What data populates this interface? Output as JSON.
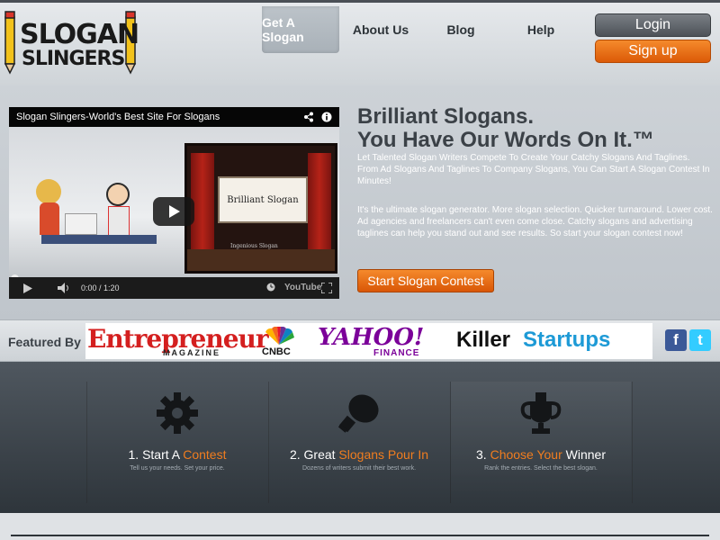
{
  "brand": {
    "line1": "SLOGAN",
    "line2": "SLINGERS"
  },
  "nav": [
    {
      "label": "Get A Slogan",
      "active": true
    },
    {
      "label": "About Us"
    },
    {
      "label": "Blog"
    },
    {
      "label": "Help"
    }
  ],
  "auth": {
    "login": "Login",
    "signup": "Sign up"
  },
  "video": {
    "title": "Slogan Slingers-World's Best Site For Slogans",
    "board_text": "Brilliant Slogan",
    "board_sub": "Ingenious Slogan",
    "time": "0:00 / 1:20",
    "youtube": "YouTube"
  },
  "hero": {
    "title_line1": "Brilliant Slogans.",
    "title_line2": "You Have Our Words On It.™",
    "para1": "Let Talented Slogan Writers Compete To Create Your Catchy Slogans And Taglines. From Ad Slogans And Taglines To Company Slogans, You Can Start A Slogan Contest In Minutes!",
    "para2": "It's the ultimate slogan generator. More slogan selection. Quicker turnaround. Lower cost. Ad agencies and freelancers can't even come close. Catchy slogans and advertising taglines can help you stand out and see results. So start your slogan contest now!",
    "cta": "Start Slogan Contest"
  },
  "featured": {
    "label": "Featured By",
    "logos": {
      "entrepreneur": "Entrepreneur",
      "entrepreneur_sub": "MAGAZINE",
      "cnbc": "CNBC",
      "yahoo": "YAHOO!",
      "yahoo_sub": "FINANCE",
      "killer": "Killer",
      "startups": "Startups"
    }
  },
  "steps": [
    {
      "prefix": "1. Start A ",
      "highlight": "Contest",
      "suffix": "",
      "sub": "Tell us your needs. Set your price.",
      "icon": "gear-icon"
    },
    {
      "prefix": "2. Great ",
      "highlight": "Slogans Pour In",
      "suffix": "",
      "sub": "Dozens of writers submit their best work.",
      "icon": "lightbulb-icon"
    },
    {
      "prefix": "3. ",
      "highlight": "Choose Your",
      "suffix": " Winner",
      "sub": "Rank the entries. Select the best slogan.",
      "icon": "trophy-icon"
    }
  ],
  "colors": {
    "accent": "#f07d1f",
    "dark": "#2e353b",
    "facebook": "#3b5998",
    "twitter": "#33ccff"
  }
}
